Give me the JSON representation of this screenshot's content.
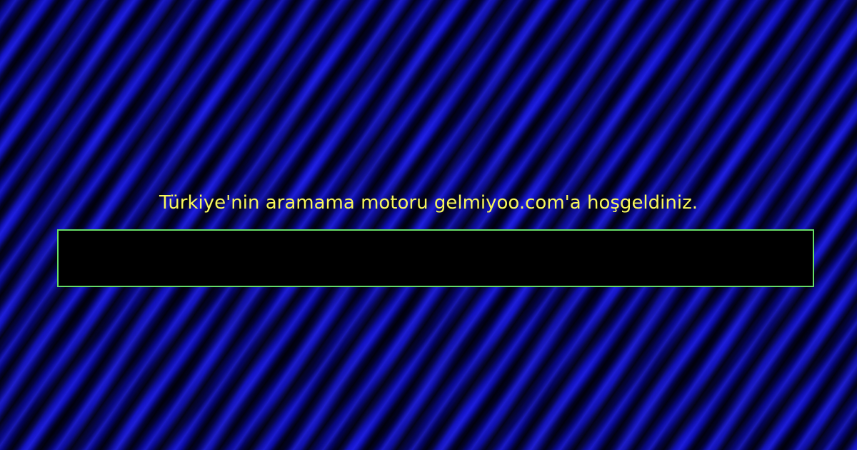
{
  "page": {
    "welcome_text": "Türkiye'nin aramama motoru gelmiyoo.com'a hoşgeldiniz."
  },
  "search": {
    "value": "",
    "placeholder": ""
  },
  "colors": {
    "background": "#0b0ba0",
    "text": "#f7f75a",
    "input_background": "#000000",
    "input_border": "#66dd66"
  }
}
